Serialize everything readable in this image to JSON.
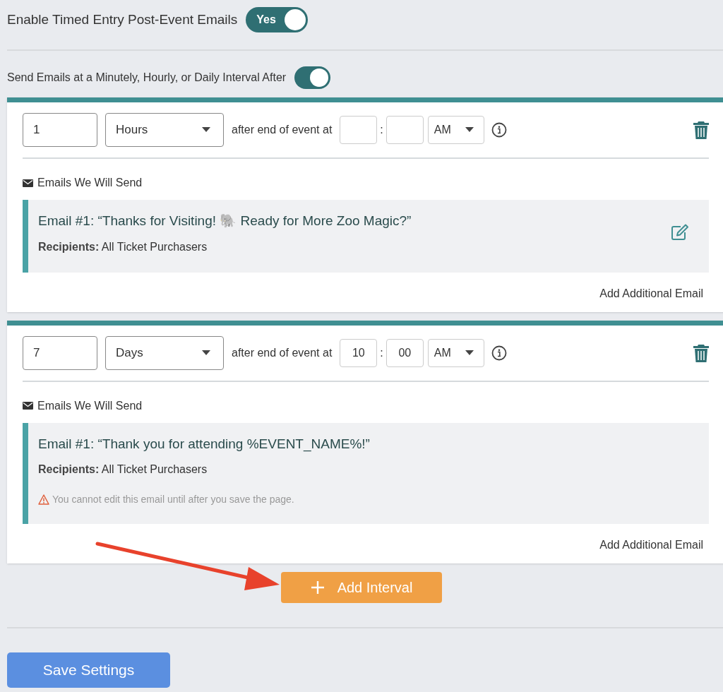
{
  "main_toggle": {
    "label": "Enable Timed Entry Post-Event Emails",
    "on": true,
    "text": "Yes"
  },
  "interval_toggle": {
    "label": "Send Emails at a Minutely, Hourly, or Daily Interval After",
    "on": true
  },
  "intervals": [
    {
      "amount": "1",
      "unit": "Hours",
      "after_text": "after end of event at",
      "separator": ":",
      "meridiem": "AM",
      "section_label": "Emails We Will Send",
      "emails": [
        {
          "title": "Email #1: “Thanks for Visiting! 🐘 Ready for More Zoo Magic?”",
          "recipients_label": "Recipients:",
          "recipients": "All Ticket Purchasers",
          "editable": true
        }
      ],
      "add_email": "Add Additional Email"
    },
    {
      "amount": "7",
      "unit": "Days",
      "after_text": "after end of event at",
      "hour": "10",
      "separator": ":",
      "minute": "00",
      "meridiem": "AM",
      "section_label": "Emails We Will Send",
      "emails": [
        {
          "title": "Email #1: “Thank you for attending %EVENT_NAME%!”",
          "recipients_label": "Recipients:",
          "recipients": "All Ticket Purchasers",
          "editable": false,
          "warning": "You cannot edit this email until after you save the page."
        }
      ],
      "add_email": "Add Additional Email"
    }
  ],
  "add_interval": "Add Interval",
  "save_button": "Save Settings"
}
